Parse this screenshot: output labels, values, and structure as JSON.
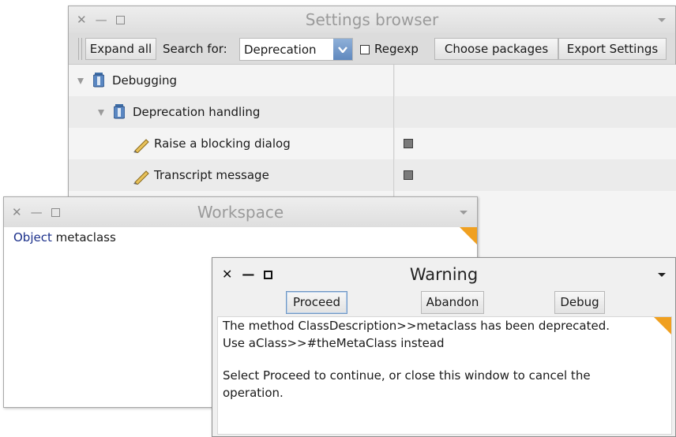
{
  "settings_window": {
    "title": "Settings browser",
    "toolbar": {
      "expand_all": "Expand all",
      "search_label": "Search for:",
      "search_value": "Deprecation",
      "regexp_label": "Regexp",
      "choose_packages": "Choose packages",
      "export_settings": "Export Settings"
    },
    "tree": [
      {
        "label": "Debugging",
        "icon": "package-icon",
        "expanded": true
      },
      {
        "label": "Deprecation handling",
        "icon": "package-icon",
        "expanded": true
      },
      {
        "label": "Raise a blocking dialog",
        "icon": "pencil-icon",
        "checked": false
      },
      {
        "label": "Transcript message",
        "icon": "pencil-icon",
        "checked": false
      }
    ]
  },
  "workspace_window": {
    "title": "Workspace",
    "code_keyword": "Object",
    "code_rest": " metaclass"
  },
  "warning_window": {
    "title": "Warning",
    "buttons": {
      "proceed": "Proceed",
      "abandon": "Abandon",
      "debug": "Debug"
    },
    "message_line1": "The method ClassDescription>>metaclass has been deprecated.",
    "message_line2": "Use aClass>>#theMetaClass instead",
    "message_line3": "Select Proceed to continue, or close this window to cancel the",
    "message_line4": "operation."
  },
  "colors": {
    "accent_blue": "#5f88be",
    "dogear_orange": "#f0a020",
    "keyword_blue": "#1a2f8a"
  }
}
